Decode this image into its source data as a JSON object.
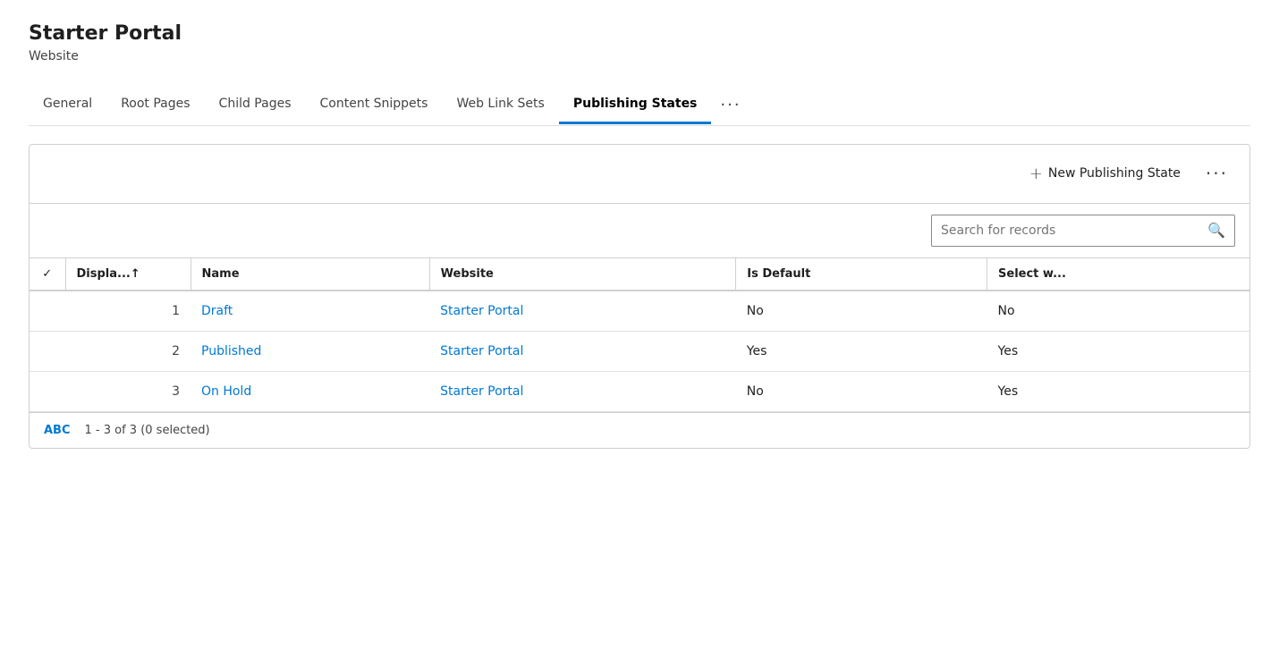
{
  "header": {
    "title": "Starter Portal",
    "subtitle": "Website"
  },
  "tabs": [
    {
      "id": "general",
      "label": "General",
      "active": false
    },
    {
      "id": "root-pages",
      "label": "Root Pages",
      "active": false
    },
    {
      "id": "child-pages",
      "label": "Child Pages",
      "active": false
    },
    {
      "id": "content-snippets",
      "label": "Content Snippets",
      "active": false
    },
    {
      "id": "web-link-sets",
      "label": "Web Link Sets",
      "active": false
    },
    {
      "id": "publishing-states",
      "label": "Publishing States",
      "active": true
    }
  ],
  "toolbar": {
    "new_button_label": "New Publishing State",
    "more_label": "···"
  },
  "search": {
    "placeholder": "Search for records"
  },
  "grid": {
    "columns": [
      {
        "id": "check",
        "label": "✓"
      },
      {
        "id": "display",
        "label": "Displa...↑"
      },
      {
        "id": "name",
        "label": "Name"
      },
      {
        "id": "website",
        "label": "Website"
      },
      {
        "id": "is_default",
        "label": "Is Default"
      },
      {
        "id": "select_w",
        "label": "Select w..."
      }
    ],
    "rows": [
      {
        "num": 1,
        "name": "Draft",
        "website": "Starter Portal",
        "is_default": "No",
        "select_w": "No"
      },
      {
        "num": 2,
        "name": "Published",
        "website": "Starter Portal",
        "is_default": "Yes",
        "select_w": "Yes"
      },
      {
        "num": 3,
        "name": "On Hold",
        "website": "Starter Portal",
        "is_default": "No",
        "select_w": "Yes"
      }
    ]
  },
  "footer": {
    "abc_label": "ABC",
    "record_count": "1 - 3 of 3 (0 selected)"
  }
}
